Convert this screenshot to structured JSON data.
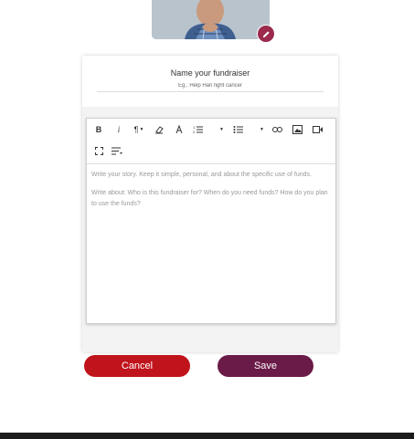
{
  "profile": {
    "photo_alt": "fundraiser photo"
  },
  "form": {
    "title_label": "Name your fundraiser",
    "title_placeholder": "Eg.: Help Hari fight cancer",
    "title_value": ""
  },
  "editor": {
    "toolbar": [
      "bold-icon",
      "italic-icon",
      "paragraph-icon",
      "eraser-icon",
      "font-color-icon",
      "ordered-list-icon",
      "unordered-list-icon",
      "link-icon",
      "image-icon",
      "video-icon",
      "fullscreen-icon",
      "line-height-icon"
    ],
    "paragraph_1": "Write your story. Keep it simple, personal, and about the specific use of funds.",
    "paragraph_2": "Write about: Who is this fundraiser for? When do you need funds? How do you plan to use the funds?"
  },
  "actions": {
    "cancel_label": "Cancel",
    "save_label": "Save"
  },
  "colors": {
    "cancel": "#c0141d",
    "save": "#6b1b48",
    "edit_badge": "#9b2a4d"
  }
}
